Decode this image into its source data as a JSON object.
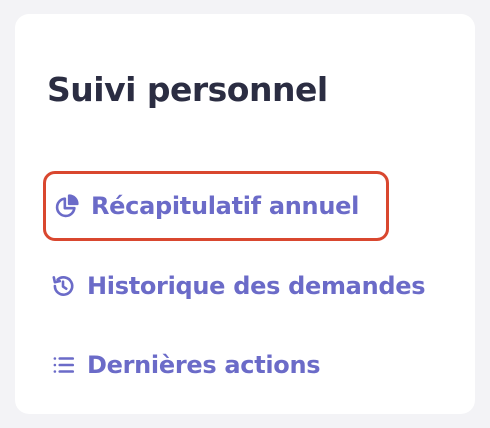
{
  "card": {
    "title": "Suivi personnel"
  },
  "nav": {
    "items": [
      {
        "label": "Récapitulatif annuel",
        "icon": "pie-chart-icon",
        "highlighted": true
      },
      {
        "label": "Historique des demandes",
        "icon": "history-icon",
        "highlighted": false
      },
      {
        "label": "Dernières actions",
        "icon": "list-icon",
        "highlighted": false
      }
    ]
  },
  "colors": {
    "link": "#6b6bc8",
    "title": "#2b2d42",
    "highlight_border": "#d9472f",
    "card_background": "#ffffff",
    "page_background": "#f3f3f6"
  }
}
